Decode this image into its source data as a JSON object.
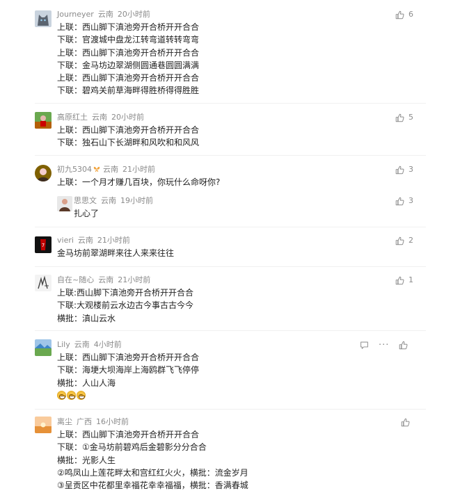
{
  "comments": [
    {
      "user": "Journeyer",
      "location": "云南",
      "time": "20小时前",
      "likes": "6",
      "lines": [
        "上联：西山脚下滇池旁开合桥开开合合",
        "下联：官渡城中盘龙江转弯道转转弯弯",
        "上联：西山脚下滇池旁开合桥开开合合",
        "下联：金马坊边翠湖侧圆通巷圆圆满满",
        "上联：西山脚下滇池旁开合桥开开合合",
        "下联：碧鸡关前草海畔得胜桥得得胜胜"
      ]
    },
    {
      "user": "高原红土",
      "location": "云南",
      "time": "20小时前",
      "likes": "5",
      "lines": [
        "上联：西山脚下滇池旁开合桥开开合合",
        "下联：独石山下长湖畔和风吹和和风风"
      ]
    },
    {
      "user": "初九5304",
      "location": "云南",
      "time": "21小时前",
      "likes": "3",
      "lines": [
        "上联：一个月才赚几百块，你玩什么命呀你?"
      ],
      "reply": {
        "user": "思思文",
        "location": "云南",
        "time": "19小时前",
        "likes": "3",
        "lines": [
          "扎心了"
        ]
      }
    },
    {
      "user": "vieri",
      "location": "云南",
      "time": "21小时前",
      "likes": "2",
      "lines": [
        "金马坊前翠湖畔来往人来来往往"
      ]
    },
    {
      "user": "自在~随心",
      "location": "云南",
      "time": "21小时前",
      "likes": "1",
      "lines": [
        "上联:西山脚下滇池旁开合桥开开合合",
        "下联:大观楼前云水边古今事古古今今",
        "横批：滇山云水"
      ]
    },
    {
      "user": "Lily",
      "location": "云南",
      "time": "4小时前",
      "likes": "",
      "lines": [
        "上联：西山脚下滇池旁开合桥开开合合",
        "下联：海埂大坝海岸上海鸥群飞飞停停",
        "横批：人山人海"
      ],
      "emojis": 3
    },
    {
      "user": "离尘",
      "location": "广西",
      "time": "16小时前",
      "likes": "",
      "lines": [
        "上联：西山脚下滇池旁开合桥开开合合",
        "下联：①金马坊前碧鸡后金碧影分分合合",
        "横批：光影人生",
        "②鸣凤山上莲花畔太和宫红红火火，横批：流金岁月",
        "③呈贡区中花都里幸福花幸幸福福，横批：香满春城"
      ]
    }
  ],
  "icons": {
    "like": "thumbs-up-icon",
    "reply": "comment-icon",
    "more": "more-icon",
    "badge": "butterfly-badge-icon"
  },
  "colors": {
    "meta": "#8a8a8a",
    "text": "#222222",
    "divider": "#f0f0f0"
  }
}
